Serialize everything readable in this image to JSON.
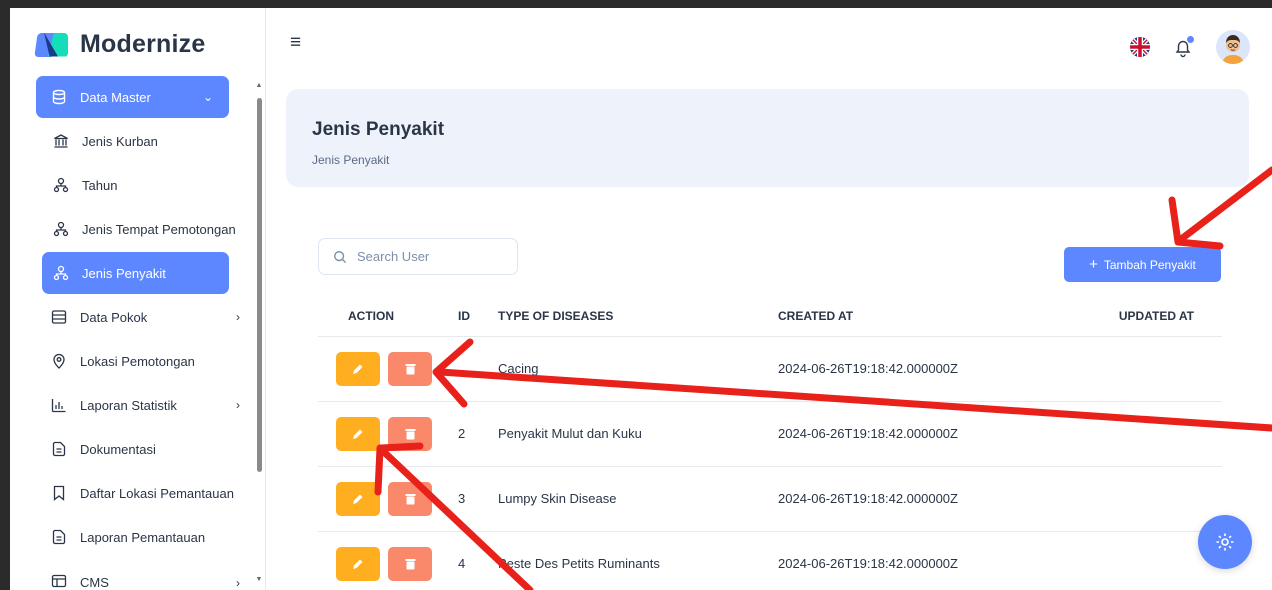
{
  "brand": {
    "name": "Modernize"
  },
  "sidebar": {
    "items": [
      {
        "label": "Data Master",
        "icon": "database-icon",
        "active": true,
        "chevron": "⌄"
      },
      {
        "label": "Jenis Kurban",
        "icon": "bank-icon"
      },
      {
        "label": "Tahun",
        "icon": "sitemap-icon"
      },
      {
        "label": "Jenis Tempat Pemotongan",
        "icon": "sitemap-icon"
      },
      {
        "label": "Jenis Penyakit",
        "icon": "sitemap-icon",
        "active": true
      },
      {
        "label": "Data Pokok",
        "icon": "table-icon",
        "chevron": "›"
      },
      {
        "label": "Lokasi Pemotongan",
        "icon": "map-pin-icon"
      },
      {
        "label": "Laporan Statistik",
        "icon": "chart-bar-icon",
        "chevron": "›"
      },
      {
        "label": "Dokumentasi",
        "icon": "file-text-icon"
      },
      {
        "label": "Daftar Lokasi Pemantauan",
        "icon": "bookmark-icon"
      },
      {
        "label": "Laporan Pemantauan",
        "icon": "file-text-icon"
      },
      {
        "label": "CMS",
        "icon": "layout-icon",
        "chevron": "›"
      }
    ]
  },
  "header": {
    "title": "Jenis Penyakit",
    "breadcrumb": "Jenis Penyakit"
  },
  "search": {
    "placeholder": "Search User"
  },
  "toolbar": {
    "add_label": "Tambah Penyakit"
  },
  "table": {
    "columns": [
      "ACTION",
      "ID",
      "TYPE OF DISEASES",
      "CREATED AT",
      "UPDATED AT"
    ],
    "rows": [
      {
        "id": "",
        "type": "Cacing",
        "created": "2024-06-26T19:18:42.000000Z",
        "updated": ""
      },
      {
        "id": "2",
        "type": "Penyakit Mulut dan Kuku",
        "created": "2024-06-26T19:18:42.000000Z",
        "updated": ""
      },
      {
        "id": "3",
        "type": "Lumpy Skin Disease",
        "created": "2024-06-26T19:18:42.000000Z",
        "updated": ""
      },
      {
        "id": "4",
        "type": "Peste Des Petits Ruminants",
        "created": "2024-06-26T19:18:42.000000Z",
        "updated": ""
      }
    ]
  },
  "colors": {
    "primary": "#5d87ff",
    "warning": "#ffae1f",
    "danger": "#fa896b",
    "annotation": "#e8221a"
  }
}
